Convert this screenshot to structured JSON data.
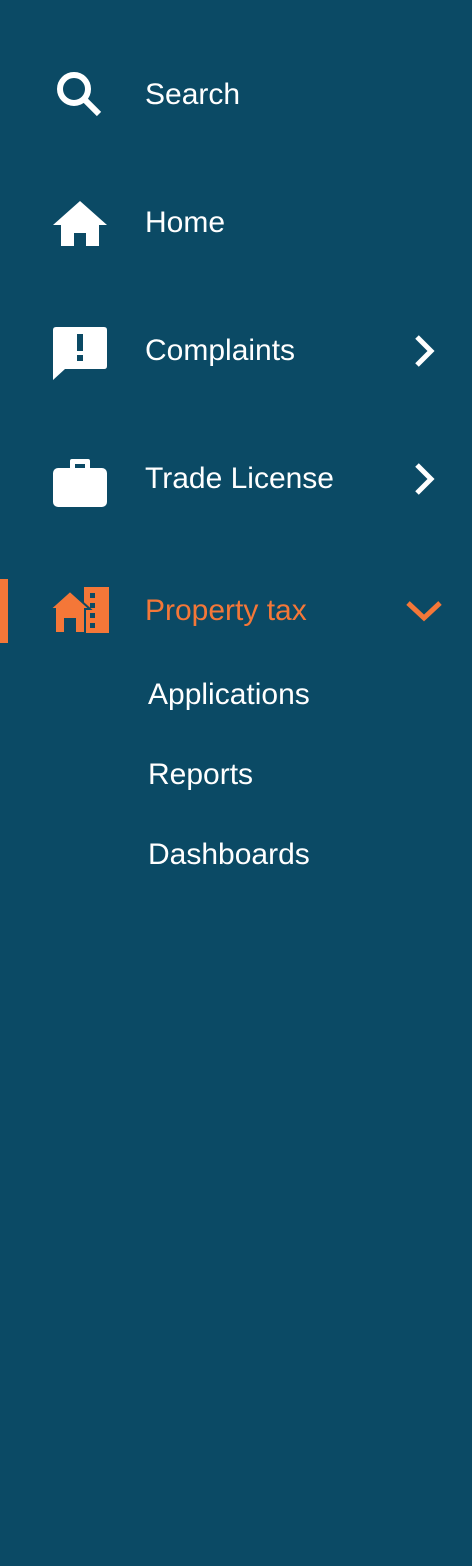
{
  "colors": {
    "background": "#0B4A65",
    "text": "#FFFFFF",
    "accent": "#F47738"
  },
  "sidebar": {
    "items": [
      {
        "label": "Search",
        "icon": "search-icon",
        "has_children": false
      },
      {
        "label": "Home",
        "icon": "home-icon",
        "has_children": false
      },
      {
        "label": "Complaints",
        "icon": "complaint-icon",
        "has_children": true
      },
      {
        "label": "Trade License",
        "icon": "briefcase-icon",
        "has_children": true
      },
      {
        "label": "Property tax",
        "icon": "property-tax-icon",
        "has_children": true,
        "active": true,
        "expanded": true,
        "children": [
          {
            "label": "Applications"
          },
          {
            "label": "Reports"
          },
          {
            "label": "Dashboards"
          }
        ]
      }
    ]
  }
}
